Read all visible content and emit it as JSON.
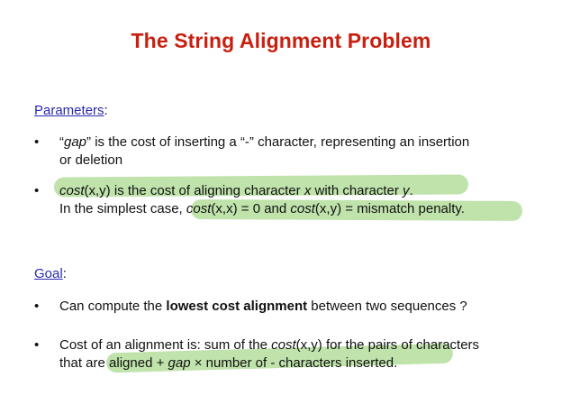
{
  "title": "The String Alignment Problem",
  "parameters_label": "Parameters",
  "goal_label": "Goal",
  "colon": ":",
  "bullet_glyph": "•",
  "b1": {
    "q1": "“",
    "gap": "gap",
    "rest_line1": "” is the cost of inserting a “-” character, representing an insertion",
    "line2": "or deletion"
  },
  "b2": {
    "cost": "cost",
    "xy": "(x,y)",
    "mid": " is the cost of aligning character ",
    "x": "x",
    "with": " with character ",
    "y": "y",
    "dot": ".",
    "l2_a": "In the simplest case, ",
    "l2_cost1": "cost",
    "l2_xx": "(x,x)",
    "l2_b": " = 0 and ",
    "l2_cost2": "cost",
    "l2_xy": "(x,y)",
    "l2_c": " = mismatch penalty."
  },
  "b3": {
    "a": "Can compute the ",
    "bold": "lowest cost alignment",
    "b": " between two sequences ?"
  },
  "b4": {
    "a": "Cost of an alignment is: sum of the ",
    "cost": "cost",
    "xy": "(x,y)",
    "b": " for the pairs of characters",
    "l2_a": "that are aligned + ",
    "gap": "gap",
    "l2_b": " × number of - characters inserted."
  },
  "highlight_color": "#a9d98f"
}
